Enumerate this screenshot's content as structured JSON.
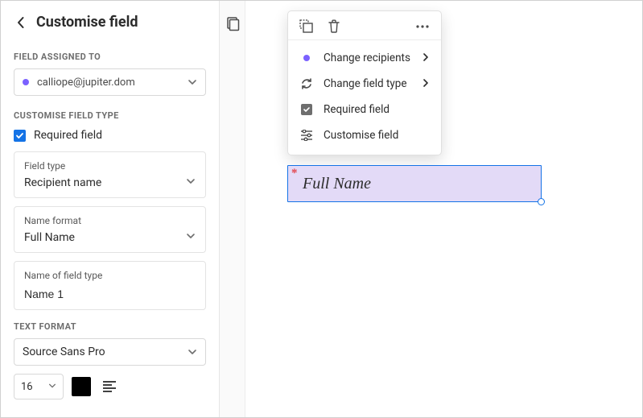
{
  "header": {
    "title": "Customise field"
  },
  "assigned_to": {
    "label": "FIELD ASSIGNED TO",
    "value": "calliope@jupiter.dom",
    "dot_color": "#7b61ff"
  },
  "customise_type": {
    "label": "CUSTOMISE FIELD TYPE",
    "required_label": "Required field",
    "required_checked": true,
    "field_type": {
      "label": "Field type",
      "value": "Recipient name"
    },
    "name_format": {
      "label": "Name format",
      "value": "Full Name"
    },
    "field_name": {
      "label": "Name of field type",
      "value": "Name 1"
    }
  },
  "text_format": {
    "label": "TEXT FORMAT",
    "font": "Source Sans Pro",
    "size": "16",
    "color": "#000000"
  },
  "popover": {
    "item_change_recipients": "Change recipients",
    "item_change_field_type": "Change field type",
    "item_required_field": "Required field",
    "item_customise_field": "Customise field"
  },
  "canvas_field": {
    "placeholder": "Full Name",
    "required_marker": "*"
  }
}
